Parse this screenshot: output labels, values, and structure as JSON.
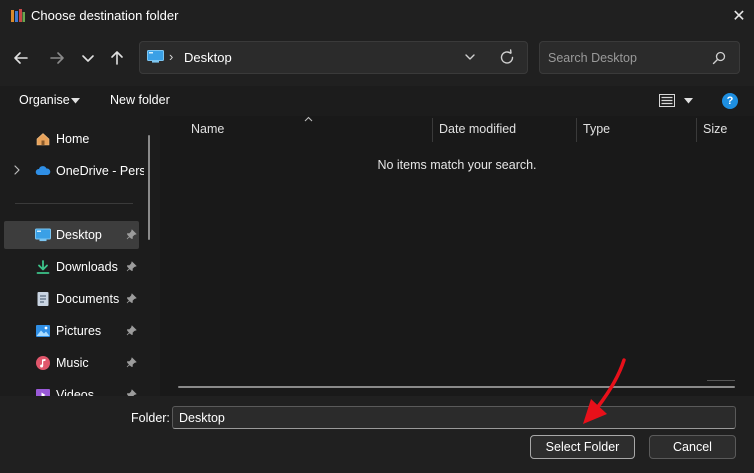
{
  "window": {
    "title": "Choose destination folder",
    "close_glyph": "✕"
  },
  "nav": {
    "back_icon": "arrow-left-icon",
    "forward_icon": "arrow-right-icon",
    "recent_icon": "chevron-down-icon",
    "up_icon": "arrow-up-icon",
    "address_separator": "›",
    "address_path": "Desktop",
    "search_placeholder": "Search Desktop"
  },
  "toolbar": {
    "organise_label": "Organise",
    "new_folder_label": "New folder",
    "help_glyph": "?"
  },
  "sidebar": {
    "items": [
      {
        "label": "Home",
        "icon": "home-icon",
        "pinned": false,
        "expandable": false
      },
      {
        "label": "OneDrive - Perso",
        "icon": "onedrive-cloud-icon",
        "pinned": false,
        "expandable": true
      },
      {
        "label": "Desktop",
        "icon": "desktop-icon",
        "pinned": true,
        "selected": true
      },
      {
        "label": "Downloads",
        "icon": "download-icon",
        "pinned": true
      },
      {
        "label": "Documents",
        "icon": "documents-icon",
        "pinned": true
      },
      {
        "label": "Pictures",
        "icon": "pictures-icon",
        "pinned": true
      },
      {
        "label": "Music",
        "icon": "music-icon",
        "pinned": true
      },
      {
        "label": "Videos",
        "icon": "videos-icon",
        "pinned": true
      }
    ]
  },
  "content": {
    "columns": [
      "Name",
      "Date modified",
      "Type",
      "Size"
    ],
    "empty_message": "No items match your search."
  },
  "footer": {
    "folder_label": "Folder:",
    "folder_value": "Desktop",
    "select_label": "Select Folder",
    "cancel_label": "Cancel"
  },
  "colors": {
    "accent": "#1e8fe1",
    "annotation_arrow": "#e8101a"
  }
}
